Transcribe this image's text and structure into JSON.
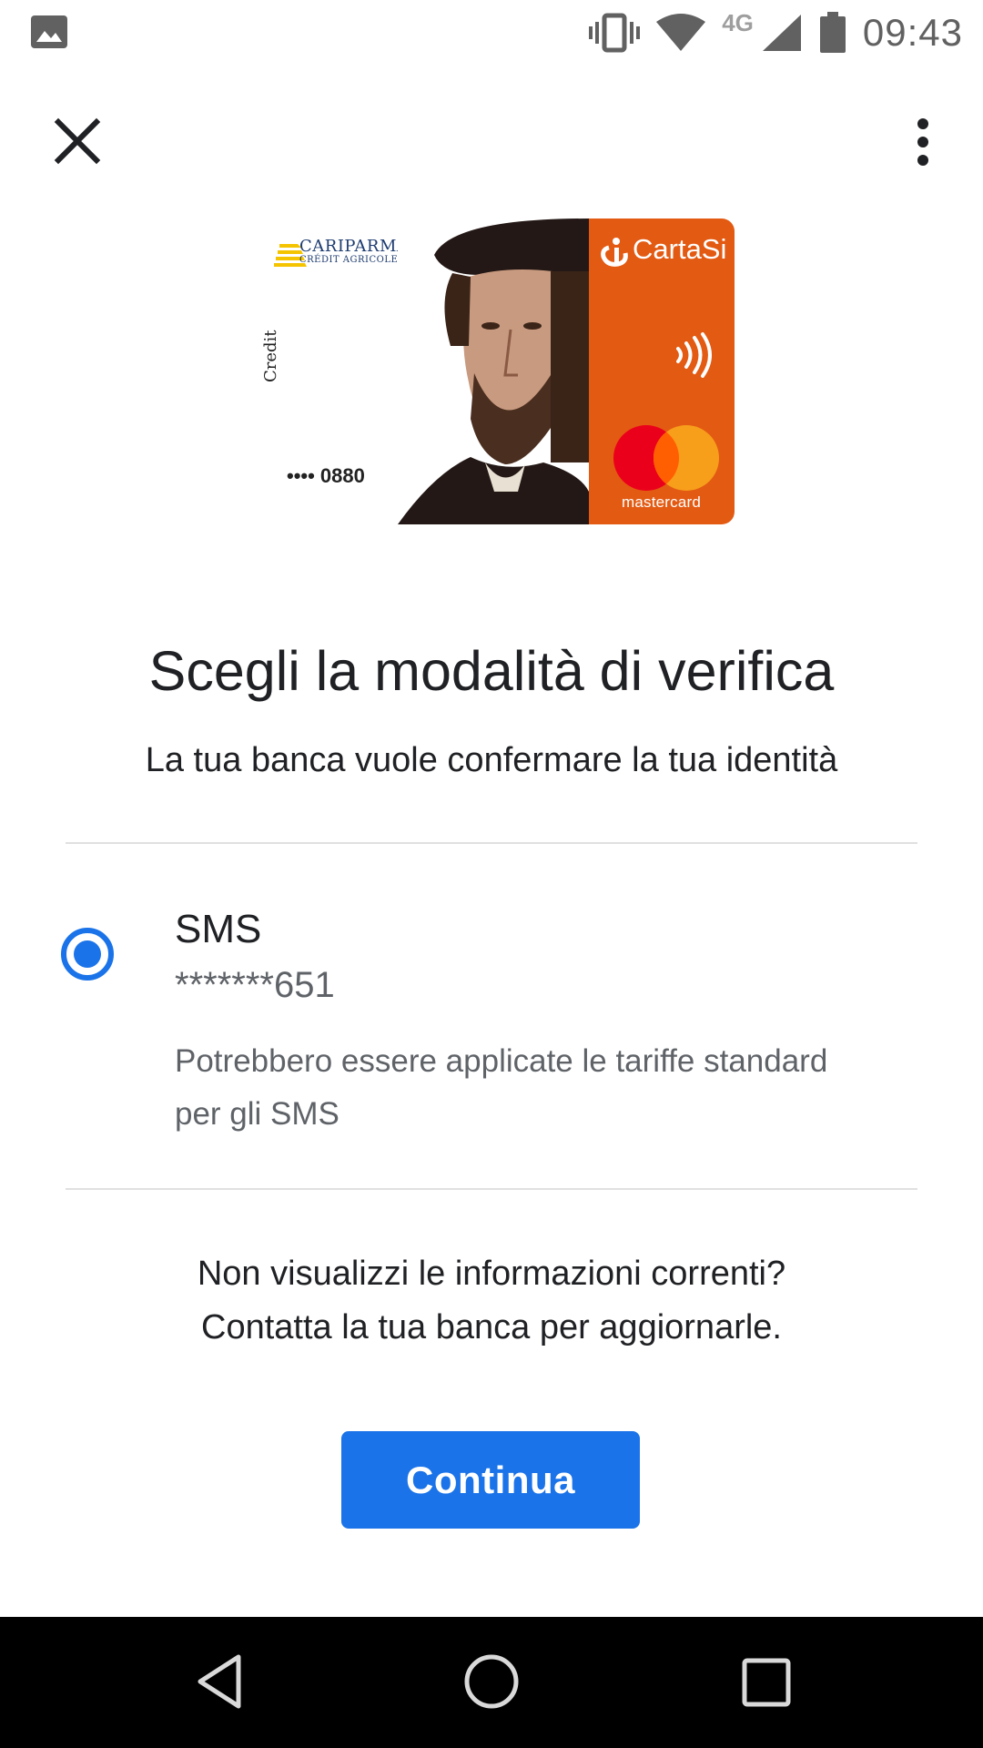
{
  "status_bar": {
    "network_label": "4G",
    "time": "09:43",
    "icons": [
      "image-notification-icon",
      "vibrate-icon",
      "wifi-icon",
      "cell-signal-icon",
      "battery-icon"
    ]
  },
  "app_bar": {
    "close_icon": "close-icon",
    "more_icon": "more-vert-icon"
  },
  "card": {
    "bank_name": "CARIPARMA",
    "bank_subtitle": "CRÉDIT AGRICOLE",
    "type_label": "Credit",
    "number_masked": "•••• 0880",
    "brand": "CartaSi",
    "network": "mastercard",
    "colors": {
      "orange": "#e35a12",
      "mc_red": "#eb001b",
      "mc_yellow": "#f79e1b"
    }
  },
  "title": "Scegli la modalità di verifica",
  "subtitle": "La tua banca vuole confermare la tua identità",
  "option": {
    "label": "SMS",
    "phone_masked": "*******651",
    "note": "Potrebbero essere applicate le tariffe standard per gli SMS",
    "selected": true
  },
  "info": {
    "line1": "Non visualizzi le informazioni correnti?",
    "line2": "Contatta la tua banca per aggiornarle."
  },
  "continue_label": "Continua",
  "accent_color": "#1a73e8",
  "nav": {
    "back_icon": "back-triangle-icon",
    "home_icon": "home-circle-icon",
    "recents_icon": "recents-square-icon"
  }
}
